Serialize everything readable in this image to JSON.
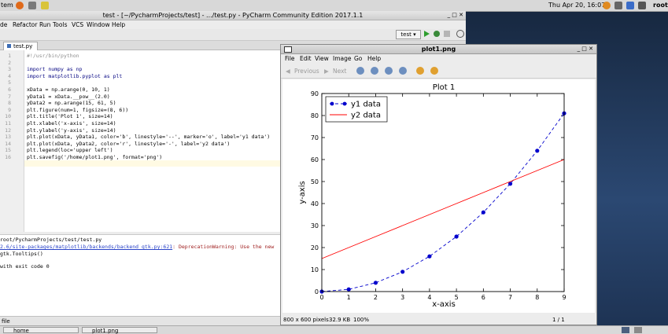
{
  "panel": {
    "left_label": "tem",
    "datetime": "Thu Apr 20, 16:07",
    "user": "root"
  },
  "pycharm": {
    "title": "test - [~/PycharmProjects/test] - .../test.py - PyCharm Community Edition 2017.1.1",
    "menu": [
      "de",
      "Refactor",
      "Run",
      "Tools",
      "VCS",
      "Window",
      "Help"
    ],
    "run_config": "test",
    "file_tab": "test.py",
    "code_lines": [
      "#!/usr/bin/python",
      "",
      "import numpy as np",
      "import matplotlib.pyplot as plt",
      "",
      "xData = np.arange(0, 10, 1)",
      "yData1 = xData.__pow__(2.0)",
      "yData2 = np.arange(15, 61, 5)",
      "plt.figure(num=1, figsize=(8, 6))",
      "plt.title('Plot 1', size=14)",
      "plt.xlabel('x-axis', size=14)",
      "plt.ylabel('y-axis', size=14)",
      "plt.plot(xData, yData1, color='b', linestyle='--', marker='o', label='y1 data')",
      "plt.plot(xData, yData2, color='r', linestyle='-', label='y2 data')",
      "plt.legend(loc='upper left')",
      "plt.savefig('/home/plot1.png', format='png')"
    ],
    "line_numbers": [
      "1",
      "2",
      "3",
      "4",
      "5",
      "6",
      "7",
      "8",
      "9",
      "10",
      "11",
      "12",
      "13",
      "14",
      "15",
      "16"
    ],
    "console": {
      "line1": "root/PycharmProjects/test/test.py",
      "line2_path": "2.6/site-packages/matplotlib/backends/backend_gtk.py:621",
      "line2_msg": ": DeprecationWarning: Use the new",
      "line3": "gtk.Tooltips()",
      "line4": "with exit code 0"
    },
    "status_left": "file"
  },
  "viewer": {
    "title": "plot1.png",
    "menu": [
      "File",
      "Edit",
      "View",
      "Image",
      "Go",
      "Help"
    ],
    "prev_label": "Previous",
    "next_label": "Next",
    "status_size": "800 x 600 pixels",
    "status_bytes": "32.9 KB",
    "status_zoom": "100%",
    "status_page": "1 / 1"
  },
  "taskbar": {
    "items": [
      "home",
      "plot1.png"
    ]
  },
  "colors": {
    "series1": "#0000cc",
    "series2": "#ff0000",
    "accent_green": "#2e9e2e"
  },
  "chart_data": {
    "type": "line",
    "title": "Plot 1",
    "xlabel": "x-axis",
    "ylabel": "y-axis",
    "xlim": [
      0,
      9
    ],
    "ylim": [
      0,
      90
    ],
    "xticks": [
      0,
      1,
      2,
      3,
      4,
      5,
      6,
      7,
      8,
      9
    ],
    "yticks": [
      0,
      10,
      20,
      30,
      40,
      50,
      60,
      70,
      80,
      90
    ],
    "legend_position": "upper-left",
    "grid": false,
    "series": [
      {
        "name": "y1 data",
        "color": "#0000cc",
        "linestyle": "dashed",
        "marker": "o",
        "x": [
          0,
          1,
          2,
          3,
          4,
          5,
          6,
          7,
          8,
          9
        ],
        "y": [
          0,
          1,
          4,
          9,
          16,
          25,
          36,
          49,
          64,
          81
        ]
      },
      {
        "name": "y2 data",
        "color": "#ff0000",
        "linestyle": "solid",
        "marker": "none",
        "x": [
          0,
          1,
          2,
          3,
          4,
          5,
          6,
          7,
          8,
          9
        ],
        "y": [
          15,
          20,
          25,
          30,
          35,
          40,
          45,
          50,
          55,
          60
        ]
      }
    ]
  }
}
